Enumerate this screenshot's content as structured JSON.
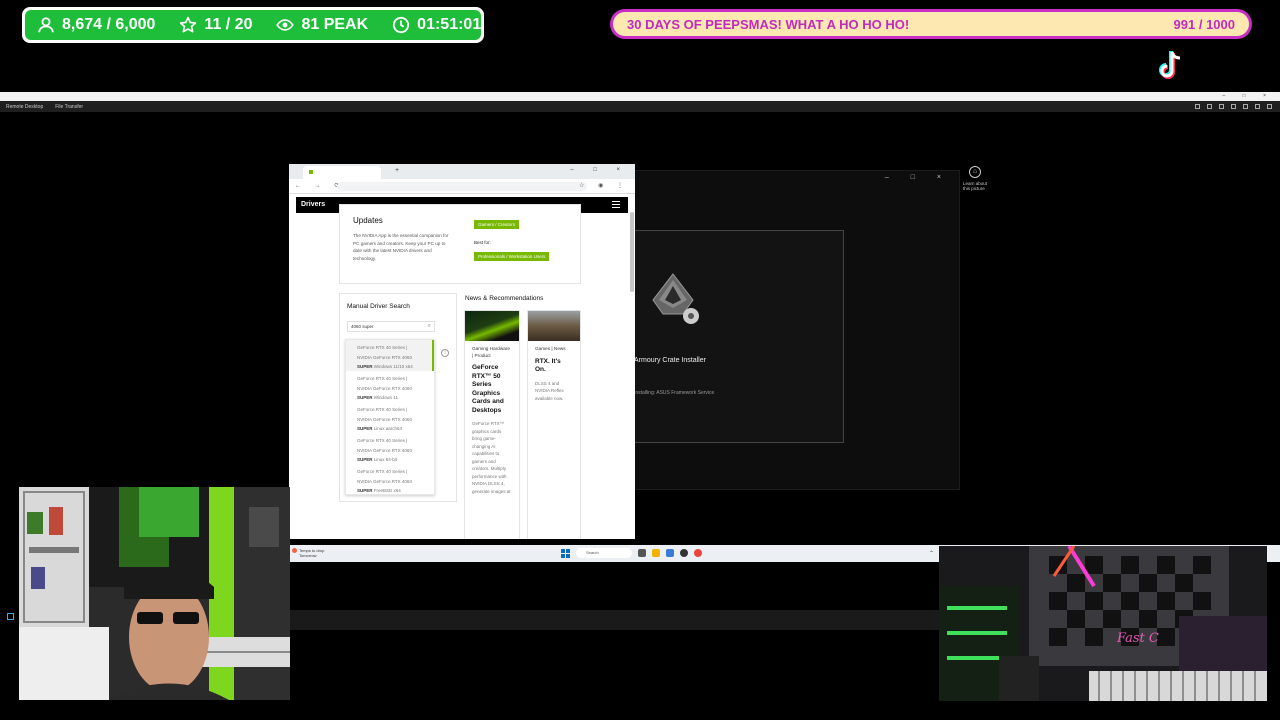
{
  "overlay": {
    "stats": {
      "followers": "8,674 / 6,000",
      "stars": "11 / 20",
      "viewers": "81 PEAK",
      "uptime": "01:51:01"
    },
    "goal": {
      "title": "30 DAYS OF PEEPSMAS! WHAT A HO HO HO!",
      "progress": "991 / 1000",
      "progress_fraction": 0.991
    },
    "colors": {
      "stats_green": "#1ebe3a",
      "goal_border": "#c52fc4",
      "goal_fill": "#fde8b1",
      "nvidia_green": "#76b900"
    }
  },
  "remote_app": {
    "tabs": [
      "Remote Desktop",
      "File Transfer"
    ]
  },
  "browser": {
    "nav_header": "Drivers",
    "updates": {
      "title": "Updates",
      "description": "The NVIDIA App is the essential companion for PC gamers and creators. Keep your PC up to date with the latest NVIDIA drivers and technology.",
      "gamers_button": "Gamers / Creators",
      "best_for": "Best for:",
      "pro_button": "Professionals / Workstation Users"
    },
    "manual_search": {
      "title": "Manual Driver Search",
      "query": "4060 super",
      "results": [
        {
          "line1": "GeForce RTX 40 Series |",
          "line2": "NVIDIA GeForce RTX 4060",
          "line3": "SUPER",
          "os": "Windows 11/10 x64"
        },
        {
          "line1": "GeForce RTX 40 Series |",
          "line2": "NVIDIA GeForce RTX 4060",
          "line3": "SUPER",
          "os": "Windows 11"
        },
        {
          "line1": "GeForce RTX 40 Series |",
          "line2": "NVIDIA GeForce RTX 4060",
          "line3": "SUPER",
          "os": "Linux aarch64"
        },
        {
          "line1": "GeForce RTX 40 Series |",
          "line2": "NVIDIA GeForce RTX 4060",
          "line3": "SUPER",
          "os": "Linux 64-bit"
        },
        {
          "line1": "GeForce RTX 40 Series |",
          "line2": "NVIDIA GeForce RTX 4060",
          "line3": "SUPER",
          "os": "FreeBSD x64"
        }
      ]
    },
    "news": {
      "title": "News & Recommendations",
      "cards": [
        {
          "category": "Gaming Hardware | Product",
          "headline": "GeForce RTX™ 50 Series Graphics Cards and Desktops",
          "description": "GeForce RTX™ graphics cards bring game-changing AI capabilities to gamers and creators. Multiply performance with NVIDIA DLSS 4, generate images at"
        },
        {
          "category": "Games | News",
          "headline": "RTX. It's On.",
          "description": "DLSS 4 and NVIDIA Reflex available now."
        }
      ]
    }
  },
  "armoury": {
    "title": "Armoury Crate Installer",
    "status": "Installing: ASUS Framework Service",
    "learn_about": "Learn about this picture"
  },
  "taskbar": {
    "search_placeholder": "Search",
    "weather": "Temps to drop",
    "weather_sub": "Tomorrow"
  }
}
